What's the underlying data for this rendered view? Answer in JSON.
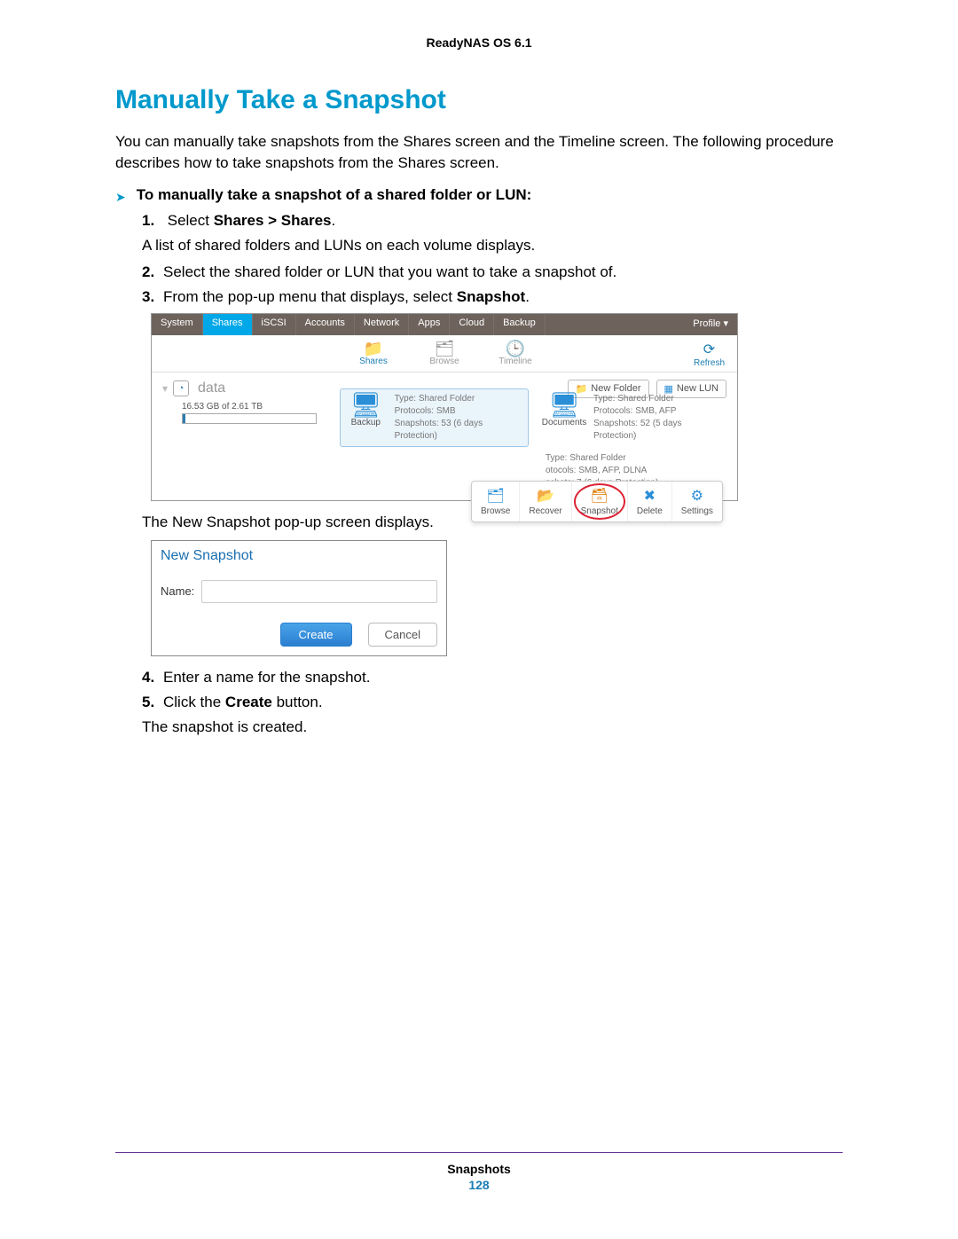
{
  "doc_header": "ReadyNAS OS 6.1",
  "section_title": "Manually Take a Snapshot",
  "intro": "You can manually take snapshots from the Shares screen and the Timeline screen. The following procedure describes how to take snapshots from the Shares screen.",
  "procedure_title": "To manually take a snapshot of a shared folder or LUN:",
  "steps": {
    "s1_prefix": "Select ",
    "s1_bold": "Shares > Shares",
    "s1_suffix": ".",
    "s1_sub": "A list of shared folders and LUNs on each volume displays.",
    "s2": "Select the shared folder or LUN that you want to take a snapshot of.",
    "s3_prefix": "From the pop-up menu that displays, select ",
    "s3_bold": "Snapshot",
    "s3_suffix": "."
  },
  "after_shot1": "The New Snapshot pop-up screen displays.",
  "steps_tail": {
    "s4": "Enter a name for the snapshot.",
    "s5_prefix": "Click the ",
    "s5_bold": "Create",
    "s5_suffix": " button.",
    "s5_sub": "The snapshot is created."
  },
  "ui": {
    "tabs": [
      "System",
      "Shares",
      "iSCSI",
      "Accounts",
      "Network",
      "Apps",
      "Cloud",
      "Backup"
    ],
    "profile": "Profile ▾",
    "toolbar": {
      "shares": "Shares",
      "browse": "Browse",
      "timeline": "Timeline",
      "refresh": "Refresh"
    },
    "volume": {
      "name": "data",
      "capacity": "16.53 GB of 2.61 TB",
      "new_folder": "New Folder",
      "new_lun": "New LUN"
    },
    "folders": [
      {
        "name": "Backup",
        "type_line": "Type: Shared Folder",
        "proto_line": "Protocols: SMB",
        "snap_line": "Snapshots: 53 (6 days Protection)"
      },
      {
        "name": "Documents",
        "type_line": "Type: Shared Folder",
        "proto_line": "Protocols: SMB, AFP",
        "snap_line": "Snapshots: 52 (5 days Protection)"
      },
      {
        "name": "",
        "type_line": "Type: Shared Folder",
        "proto_line": "otocols: SMB, AFP, DLNA",
        "snap_line": "pshots: 7 (6 days Protection)"
      }
    ],
    "popup": {
      "browse": "Browse",
      "recover": "Recover",
      "snapshot": "Snapshot",
      "delete": "Delete",
      "settings": "Settings"
    }
  },
  "dialog": {
    "title": "New Snapshot",
    "name_label": "Name:",
    "create": "Create",
    "cancel": "Cancel"
  },
  "footer": {
    "section": "Snapshots",
    "page": "128"
  }
}
